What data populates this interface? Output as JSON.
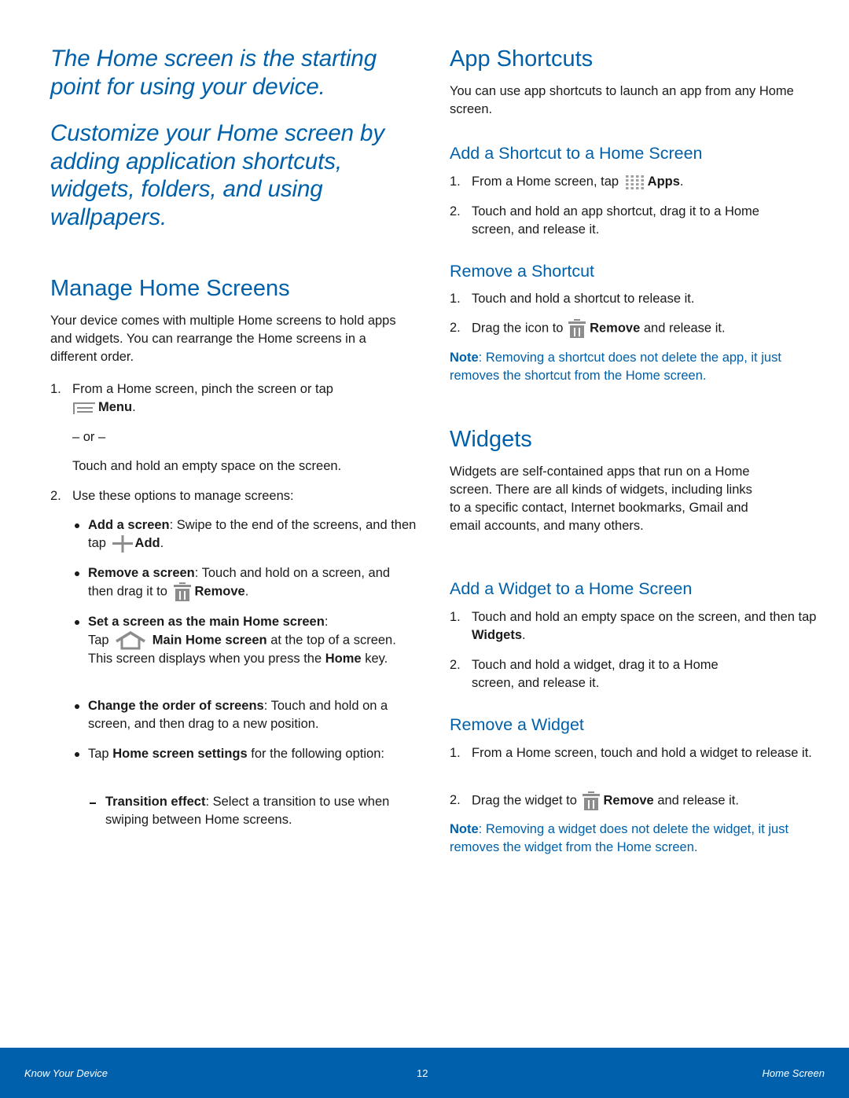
{
  "intro": {
    "line1": "The Home screen is the starting point for using your device.",
    "line2": "Customize your Home screen by adding application shortcuts, widgets, folders, and using wallpapers."
  },
  "manage": {
    "title": "Manage Home Screens",
    "body": "Your device comes with multiple Home screens to hold apps and widgets. You can rearrange the Home screens in a different order.",
    "step1_num": "1.",
    "step1_text": "From a Home screen, pinch the screen or tap",
    "step1_icon_label": "Menu",
    "or_text": "– or –",
    "alt_text": "Touch and hold an empty space on the screen.",
    "step2_num": "2.",
    "step2_text": "Use these options to manage screens:",
    "options": [
      {
        "bold": "Add a screen",
        "text": ": Swipe to the end of the screens, and then tap",
        "icon_label": "Add"
      },
      {
        "bold": "Remove a screen",
        "text": ": Touch and hold on a screen, and then drag it to",
        "icon_label": "Remove"
      },
      {
        "bold": "Set a screen as the main Home screen",
        "text_pre": "Tap",
        "icon_label": "Main Home screen",
        "text_post": "at the top of a screen. This screen displays when you press the",
        "home_key": "Home",
        "text_end": "key."
      },
      {
        "bold": "Change the order of screens",
        "text": ": Touch and hold on a screen, and then drag to a new position."
      },
      {
        "text_pre": "Tap",
        "bold": "Home screen settings",
        "text": "for the following option:"
      }
    ],
    "sub_option": {
      "bold": "Transition effect",
      "text": ": Select a transition to use when swiping between Home screens."
    }
  },
  "shortcuts": {
    "title": "App Shortcuts",
    "body": "You can use app shortcuts to launch an app from any Home screen.",
    "add_title": "Add a Shortcut to a Home Screen",
    "add_step1_text": "From a Home screen, tap",
    "add_step1_icon_label": "Apps",
    "add_step2_text": "Touch and hold an app shortcut, drag it to a Home screen, and release it.",
    "remove_title": "Remove a Shortcut",
    "remove_step1_text": "Touch and hold a shortcut to release it.",
    "remove_step2_text": "Drag the icon to",
    "remove_step2_icon_label": "Remove",
    "remove_step2_end": "and release it.",
    "note_label": "Note",
    "note_text": ": Removing a shortcut does not delete the app, it just removes the shortcut from the Home screen."
  },
  "widgets": {
    "title": "Widgets",
    "body": "Widgets are self-contained apps that run on a Home screen. There are all kinds of widgets, including links to a specific contact, Internet bookmarks, Gmail and email accounts, and many others.",
    "add_title": "Add a Widget to a Home Screen",
    "add_step1_text": "Touch and hold an empty space on the screen, and then tap",
    "add_step1_bold": "Widgets",
    "add_step2_text": "Touch and hold a widget, drag it to a Home screen, and release it.",
    "remove_title": "Remove a Widget",
    "remove_step1_text": "From a Home screen, touch and hold a widget to release it.",
    "remove_step2_text": "Drag the widget to",
    "remove_step2_icon_label": "Remove",
    "remove_step2_end": "and release it.",
    "note_label": "Note",
    "note_text": ": Removing a widget does not delete the widget, it just removes the widget from the Home screen."
  },
  "footer": {
    "left": "Know Your Device",
    "page": "12",
    "right": "Home Screen"
  },
  "colors": {
    "accent": "#0060a9",
    "footer_bg": "#0060ac",
    "icon_gray": "#8c8c8c"
  }
}
